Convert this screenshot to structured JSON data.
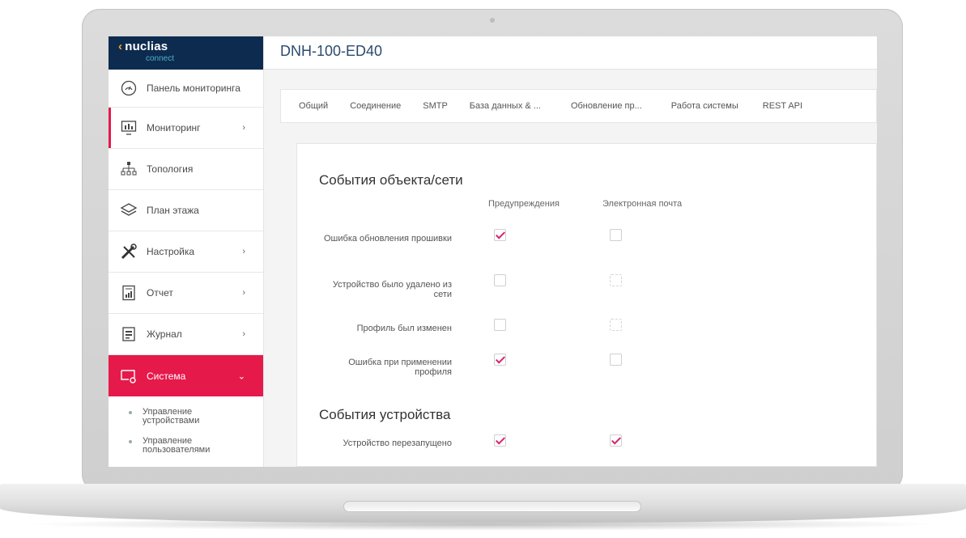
{
  "brand": {
    "name": "nuclias",
    "sub": "connect"
  },
  "page_title": "DNH-100-ED40",
  "sidebar": {
    "items": [
      {
        "label": "Панель мониторинга",
        "icon": "dashboard-gauge-icon",
        "arrow": ""
      },
      {
        "label": "Мониторинг",
        "icon": "monitoring-icon",
        "arrow": "›"
      },
      {
        "label": "Топология",
        "icon": "topology-icon",
        "arrow": ""
      },
      {
        "label": "План этажа",
        "icon": "floor-plan-icon",
        "arrow": ""
      },
      {
        "label": "Настройка",
        "icon": "tools-icon",
        "arrow": "›"
      },
      {
        "label": "Отчет",
        "icon": "report-icon",
        "arrow": "›"
      },
      {
        "label": "Журнал",
        "icon": "log-icon",
        "arrow": "›"
      },
      {
        "label": "Система",
        "icon": "system-icon",
        "arrow": "⌄"
      }
    ],
    "subitems": [
      {
        "label": "Управление устройствами"
      },
      {
        "label": "Управление пользователями"
      }
    ]
  },
  "tabs": [
    "Общий",
    "Соединение",
    "SMTP",
    "База данных & ...",
    "Обновление пр...",
    "Работа системы",
    "REST API"
  ],
  "sections": {
    "object_events_title": "События объекта/сети",
    "device_events_title": "События устройства",
    "col_warnings": "Предупреждения",
    "col_email": "Электронная почта"
  },
  "rows": [
    {
      "label": "Ошибка обновления прошивки",
      "warnings": true,
      "email": false,
      "email_state": "enabled"
    },
    {
      "label": "Устройство было удалено из сети",
      "warnings": false,
      "email": false,
      "email_state": "disabled"
    },
    {
      "label": "Профиль был изменен",
      "warnings": false,
      "email": false,
      "email_state": "disabled"
    },
    {
      "label": "Ошибка при применении профиля",
      "warnings": true,
      "email": false,
      "email_state": "enabled"
    },
    {
      "label": "Устройство перезапущено",
      "warnings": true,
      "email": true,
      "email_state": "enabled"
    }
  ],
  "colors": {
    "accent": "#e6194b",
    "header": "#0d2b4f",
    "check": "#d6246e"
  }
}
